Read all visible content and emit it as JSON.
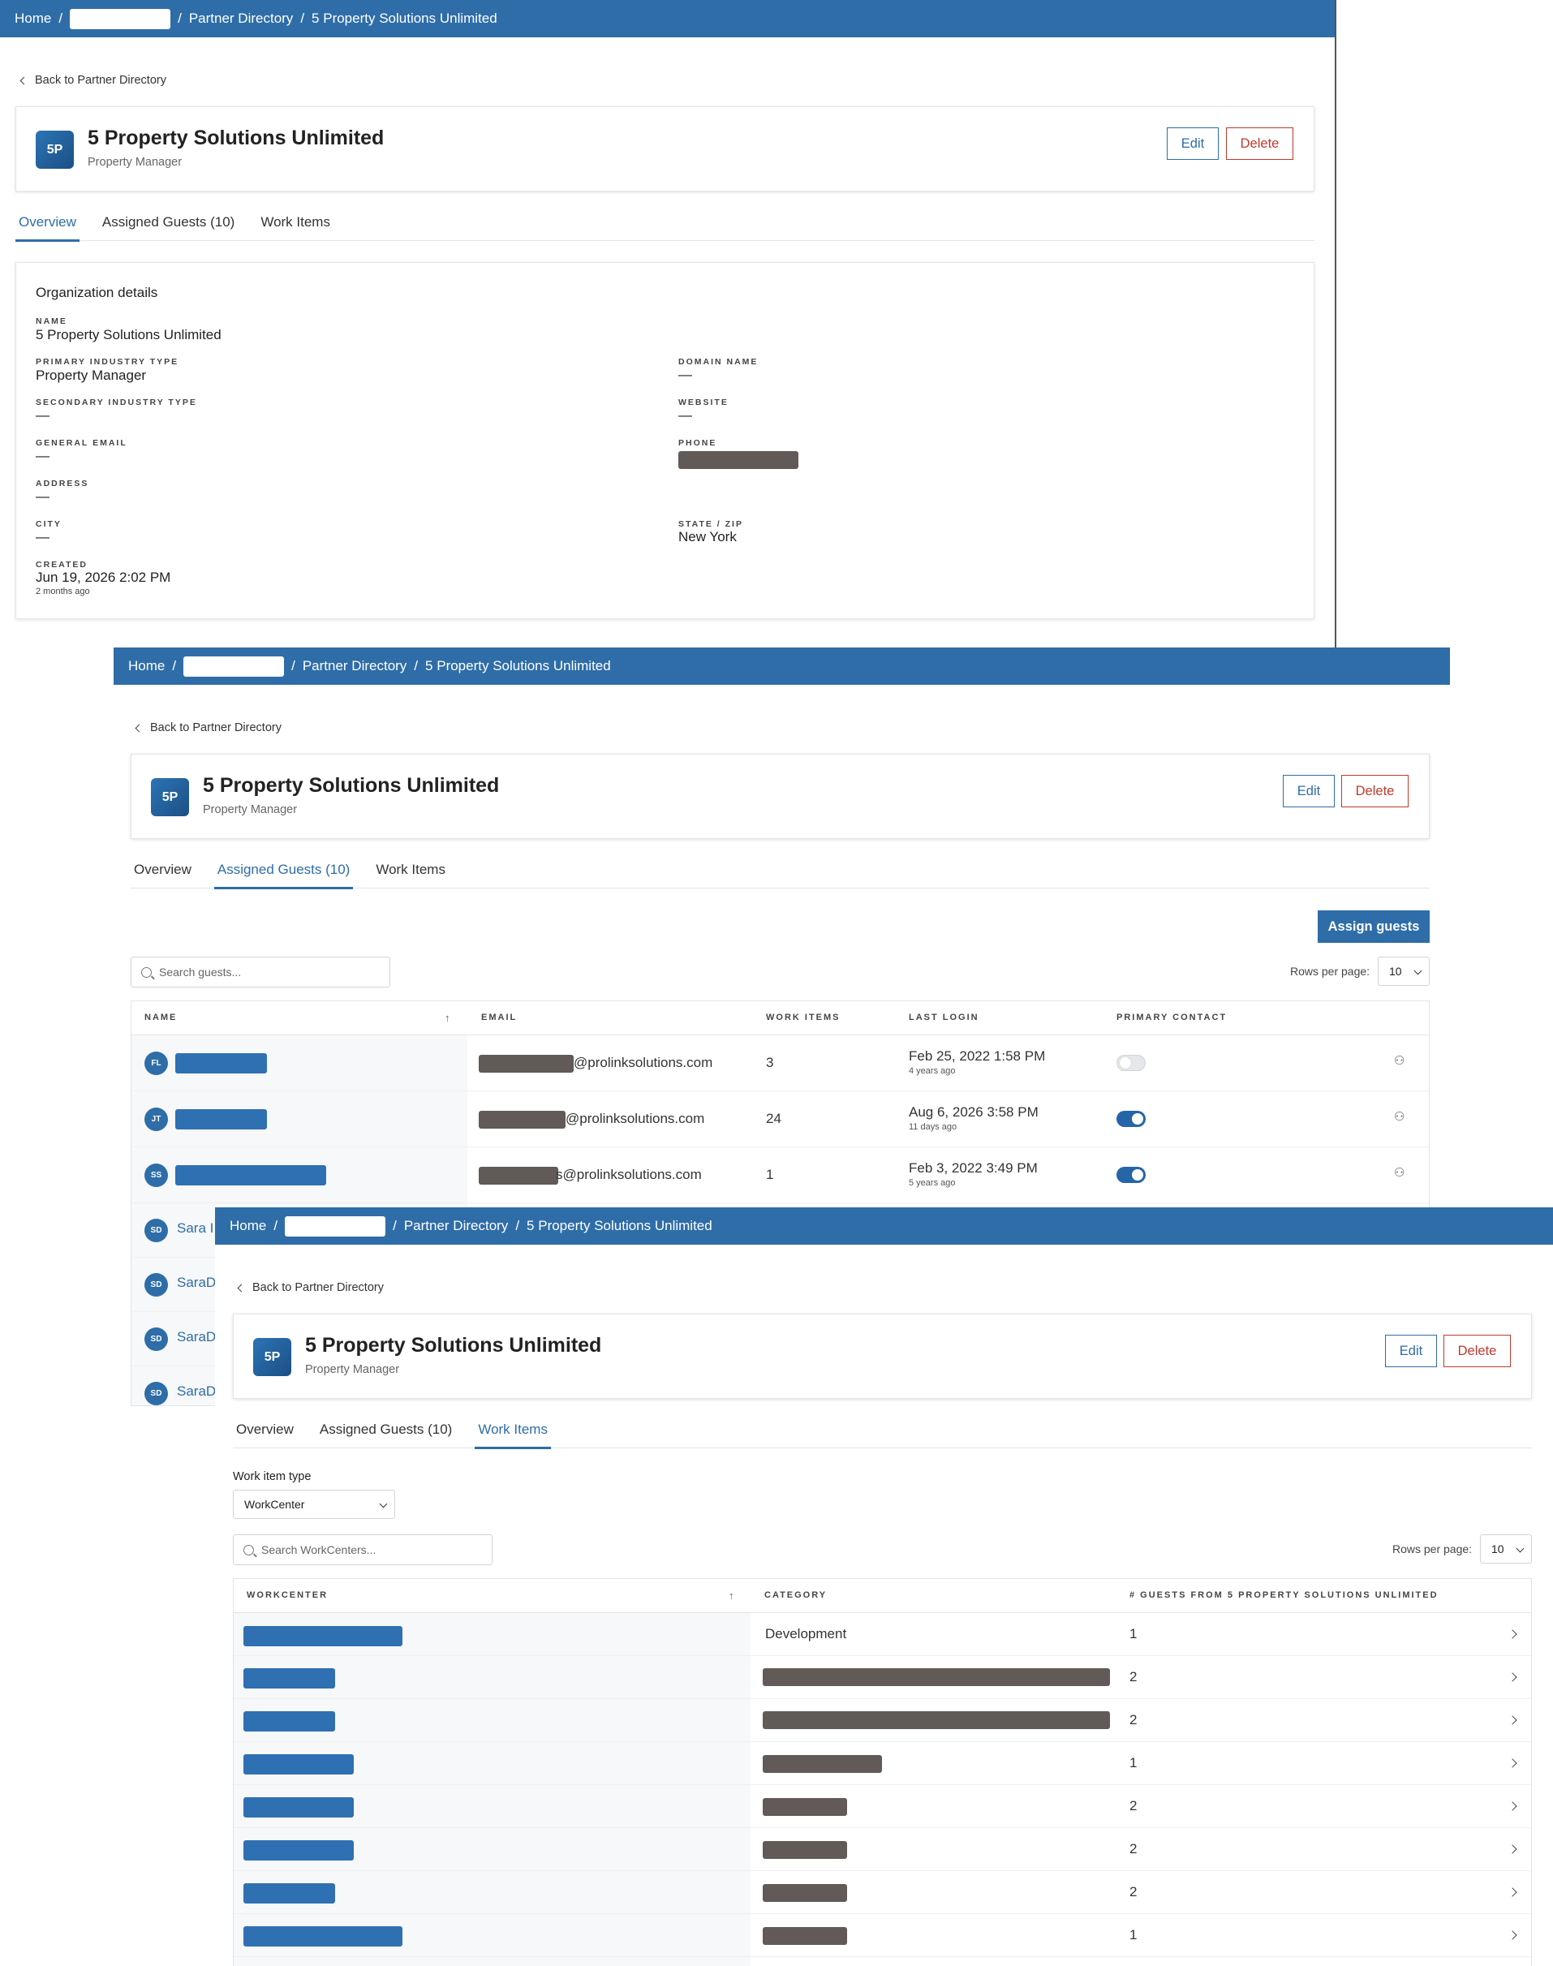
{
  "breadcrumb": {
    "home": "Home",
    "separator": "/",
    "partner_directory": "Partner Directory",
    "current": "5 Property Solutions Unlimited"
  },
  "back_link": "Back to Partner Directory",
  "org": {
    "initials": "5P",
    "name": "5 Property Solutions Unlimited",
    "type": "Property Manager"
  },
  "buttons": {
    "edit": "Edit",
    "delete": "Delete",
    "assign_guests": "Assign guests"
  },
  "tabs": {
    "overview": "Overview",
    "assigned_guests": "Assigned Guests (10)",
    "work_items": "Work Items"
  },
  "overview": {
    "section_title": "Organization details",
    "fields": {
      "name_label": "NAME",
      "name_value": "5 Property Solutions Unlimited",
      "primary_industry_label": "PRIMARY INDUSTRY TYPE",
      "primary_industry_value": "Property Manager",
      "domain_label": "DOMAIN NAME",
      "domain_value": "—",
      "secondary_industry_label": "SECONDARY INDUSTRY TYPE",
      "secondary_industry_value": "—",
      "website_label": "WEBSITE",
      "website_value": "—",
      "general_email_label": "GENERAL EMAIL",
      "general_email_value": "—",
      "phone_label": "PHONE",
      "address_label": "ADDRESS",
      "address_value": "—",
      "city_label": "CITY",
      "city_value": "—",
      "state_zip_label": "STATE / ZIP",
      "state_zip_value": "New York",
      "created_label": "CREATED",
      "created_value": "Jun 19, 2026 2:02 PM",
      "created_relative": "2 months ago"
    }
  },
  "guests": {
    "search_placeholder": "Search guests...",
    "rows_per_page_label": "Rows per page:",
    "rows_per_page_value": "10",
    "columns": {
      "name": "NAME",
      "email": "EMAIL",
      "work_items": "WORK ITEMS",
      "last_login": "LAST LOGIN",
      "primary_contact": "PRIMARY CONTACT"
    },
    "rows": [
      {
        "initials": "FL",
        "email_domain": "@prolinksolutions.com",
        "work_items": "3",
        "last_login": "Feb 25, 2022 1:58 PM",
        "last_login_rel": "4 years ago",
        "primary": false
      },
      {
        "initials": "JT",
        "email_domain": "@prolinksolutions.com",
        "work_items": "24",
        "last_login": "Aug 6, 2026 3:58 PM",
        "last_login_rel": "11 days ago",
        "primary": true
      },
      {
        "initials": "SS",
        "email_domain": "s@prolinksolutions.com",
        "work_items": "1",
        "last_login": "Feb 3, 2022 3:49 PM",
        "last_login_rel": "5 years ago",
        "primary": true
      },
      {
        "initials": "SD",
        "name_partial": "Sara I"
      },
      {
        "initials": "SD",
        "name_partial": "SaraD"
      },
      {
        "initials": "SD",
        "name_partial": "SaraD"
      },
      {
        "initials": "SD",
        "name_partial": "SaraD"
      }
    ]
  },
  "work_items": {
    "type_label": "Work item type",
    "type_value": "WorkCenter",
    "search_placeholder": "Search WorkCenters...",
    "rows_per_page_label": "Rows per page:",
    "rows_per_page_value": "10",
    "columns": {
      "workcenter": "WORKCENTER",
      "category": "CATEGORY",
      "guests": "# GUESTS FROM 5 PROPERTY SOLUTIONS UNLIMITED"
    },
    "rows": [
      {
        "category": "Development",
        "guests": "1"
      },
      {
        "guests": "2"
      },
      {
        "guests": "2"
      },
      {
        "guests": "1"
      },
      {
        "guests": "2"
      },
      {
        "guests": "2"
      },
      {
        "guests": "2"
      },
      {
        "guests": "1"
      }
    ]
  },
  "colors": {
    "brand": "#2e6da8",
    "danger": "#c0392b",
    "redaction": "#615a57"
  }
}
